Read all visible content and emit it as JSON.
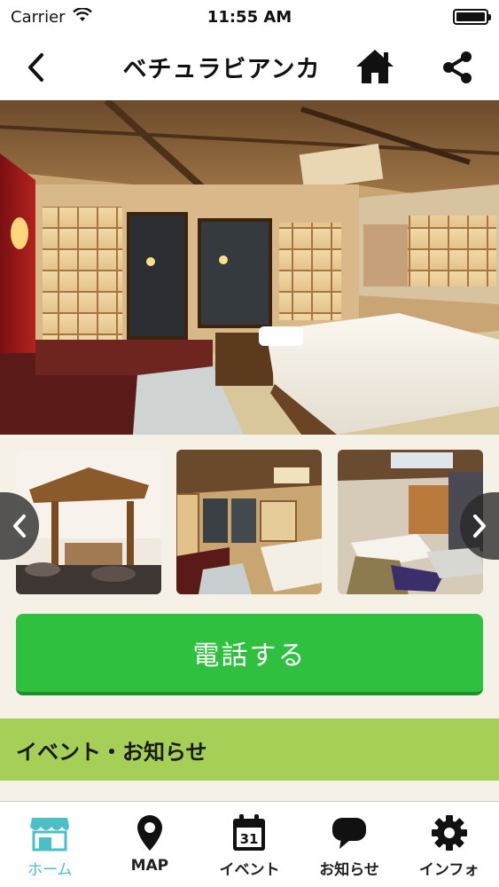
{
  "status_bar": {
    "carrier": "Carrier",
    "time": "11:55 AM",
    "battery_level": 1.0
  },
  "nav": {
    "title": "ベチュラビアンカ"
  },
  "call_button": {
    "label": "電話する"
  },
  "section": {
    "title": "イベント・お知らせ"
  },
  "tabs": [
    {
      "label": "ホーム",
      "icon": "store-icon",
      "active": true
    },
    {
      "label": "MAP",
      "icon": "map-pin-icon",
      "active": false
    },
    {
      "label": "イベント",
      "icon": "calendar-icon",
      "active": false,
      "icon_text": "31"
    },
    {
      "label": "お知らせ",
      "icon": "chat-bubble-icon",
      "active": false
    },
    {
      "label": "インフォ",
      "icon": "gear-icon",
      "active": false
    }
  ],
  "colors": {
    "accent_green": "#2fc040",
    "section_green": "#a5cf57",
    "active_tab": "#4bbfc6",
    "background": "#f5f1e6"
  }
}
